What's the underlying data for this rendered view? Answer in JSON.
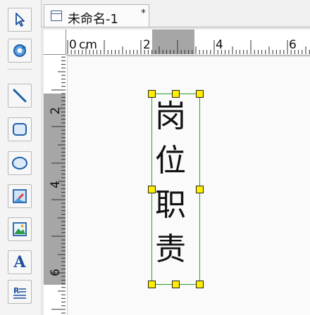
{
  "tab": {
    "title": "未命名-1",
    "modified_marker": "*"
  },
  "toolbar": {
    "tools": [
      "select-arrow-icon",
      "rotate-icon",
      "line-icon",
      "rectangle-icon",
      "ellipse-icon",
      "image-edit-icon",
      "picture-icon",
      "text-icon",
      "paragraph-icon"
    ],
    "text_tool_label": "A"
  },
  "ruler": {
    "unit": "cm",
    "h_labels": [
      "0",
      "2",
      "4",
      "6"
    ],
    "v_labels": [
      "2",
      "4",
      "6"
    ]
  },
  "label_text": "岗位职责",
  "colors": {
    "selection": "#2ca02c",
    "handle": "#ffee00",
    "ruler_highlight": "#a6a6a6"
  }
}
